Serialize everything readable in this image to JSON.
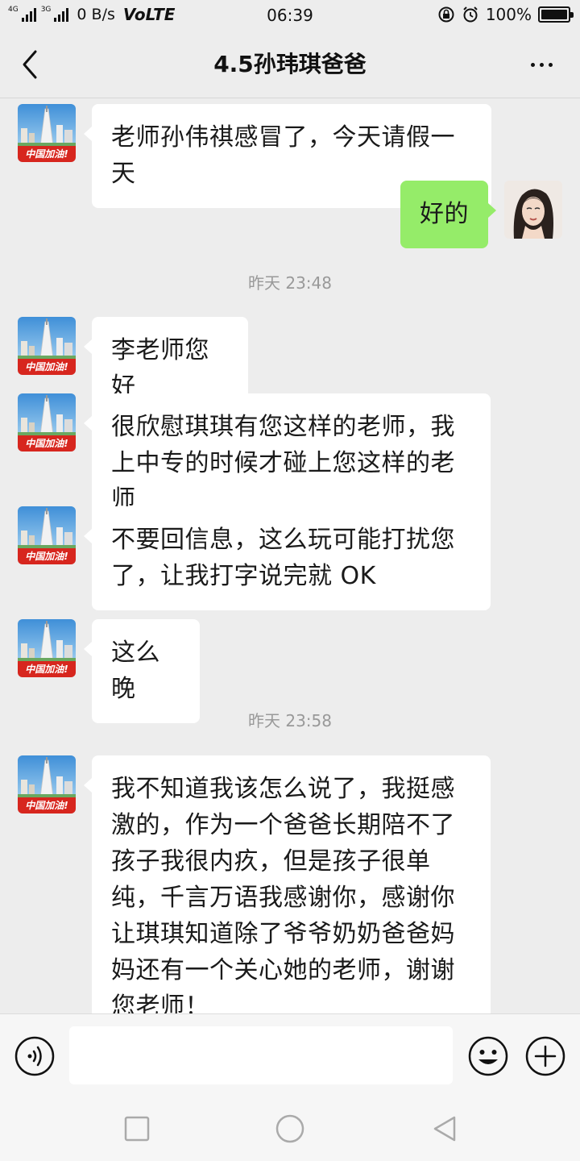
{
  "status_bar": {
    "net_tag_1": "4G",
    "net_tag_2": "3G",
    "speed": "0 B/s",
    "volte": "VoLTE",
    "time": "06:39",
    "battery": "100%",
    "battery_level": 1.0
  },
  "header": {
    "title": "4.5孙玮琪爸爸"
  },
  "messages": [
    {
      "side": "left",
      "text": "老师孙伟祺感冒了，今天请假一天"
    },
    {
      "side": "right",
      "text": "好的"
    },
    {
      "type": "time",
      "text": "昨天 23:48"
    },
    {
      "side": "left",
      "text": "李老师您好"
    },
    {
      "side": "left",
      "text": "很欣慰琪琪有您这样的老师，我上中专的时候才碰上您这样的老师"
    },
    {
      "side": "left",
      "text": "不要回信息，这么玩可能打扰您了，让我打字说完就 OK"
    },
    {
      "side": "left",
      "text": "这么晚"
    },
    {
      "type": "time",
      "text": "昨天 23:58"
    },
    {
      "side": "left",
      "text": "我不知道我该怎么说了，我挺感激的，作为一个爸爸长期陪不了孩子我很内疚，但是孩子很单纯，千言万语我感谢你，感谢你让琪琪知道除了爷爷奶奶爸爸妈妈还有一个关心她的老师，谢谢您老师！"
    }
  ],
  "contact_avatar": {
    "badge_text": "中国加油!"
  },
  "input_bar": {
    "value": "",
    "placeholder": ""
  },
  "colors": {
    "background": "#ededed",
    "bubble_incoming": "#ffffff",
    "bubble_outgoing": "#95ec69",
    "timestamp": "#999999",
    "badge_red": "#d7261e"
  },
  "icons": {
    "back": "chevron-left-icon",
    "more": "more-dots-icon",
    "voice": "voice-icon",
    "emoji": "emoji-icon",
    "add": "plus-icon",
    "nav_recent": "square-icon",
    "nav_home": "circle-icon",
    "nav_back": "triangle-back-icon"
  }
}
